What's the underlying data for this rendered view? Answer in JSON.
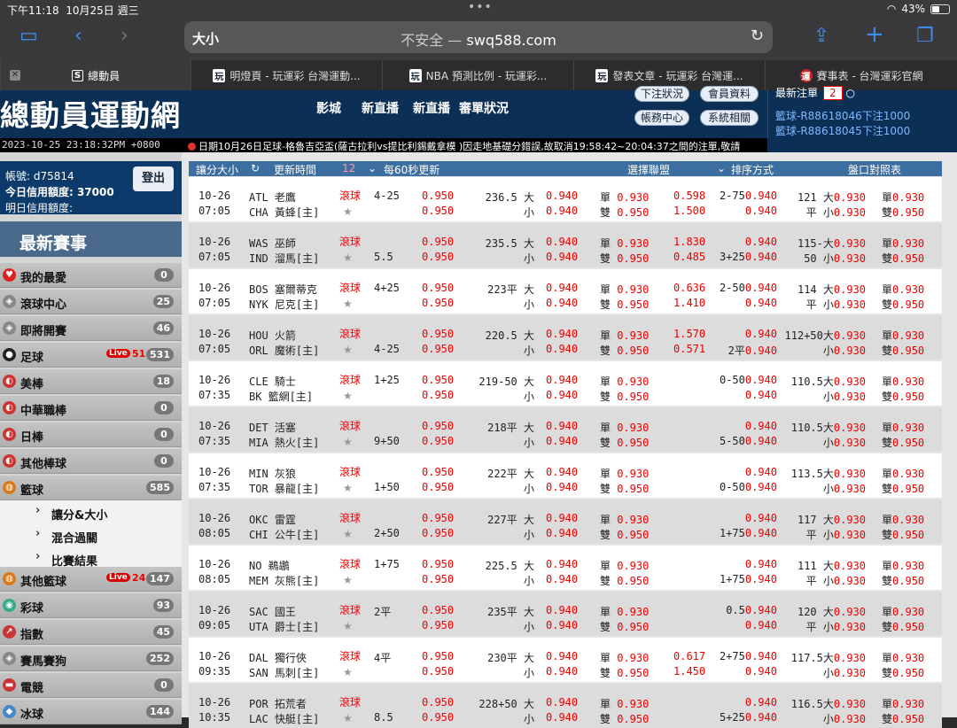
{
  "status": {
    "time": "下午11:18",
    "date": "10月25日 週三",
    "battery": "43%",
    "battery_level": 0.43,
    "dots": "•••"
  },
  "browser": {
    "aa": "大小",
    "insecure": "不安全 — ",
    "domain": "swq588.com",
    "tabs": [
      {
        "label": "總動員",
        "icon": "S"
      },
      {
        "label": "明燈頁 - 玩運彩 台灣運動...",
        "icon": "玩"
      },
      {
        "label": "NBA 預測比例 - 玩運彩...",
        "icon": "玩"
      },
      {
        "label": "發表文章 - 玩運彩 台灣運...",
        "icon": "玩"
      },
      {
        "label": "賽事表 - 台灣運彩官網",
        "icon": "運"
      }
    ]
  },
  "site": {
    "logo": "總動員運動網",
    "nav": [
      "影城",
      "新直播",
      "新直播",
      "審單狀況"
    ],
    "buttons": {
      "pending": "下注狀況",
      "member": "會員資料",
      "account": "帳務中心",
      "system": "系統相關"
    },
    "recent": {
      "label": "最新注單",
      "count": "2"
    },
    "recent_bets": [
      "籃球-R88618046下注1000",
      "籃球-R88618045下注1000"
    ],
    "ticker_time": "2023-10-25 23:18:32PM +0800",
    "ticker": "日期10月26日足球-格魯吉亞盃(薩古拉利vs提比利錫戴拿模 )因走地基礎分錯誤,故取消19:58:42~20:04:37之間的注單,敬請"
  },
  "account": {
    "id": "帳號: d75814",
    "credit": "今日信用額度: 37000",
    "tomorrow": "明日信用額度:",
    "logout": "登出"
  },
  "sidebar": {
    "title": "最新賽事",
    "items": [
      {
        "label": "我的最愛",
        "count": "0",
        "icon": "heart-icon",
        "color": "#e02020"
      },
      {
        "label": "滾球中心",
        "count": "25",
        "icon": "shield-icon",
        "color": "#888"
      },
      {
        "label": "即將開賽",
        "count": "46",
        "icon": "shield-icon",
        "color": "#888"
      },
      {
        "label": "足球",
        "count": "531",
        "icon": "soccer-icon",
        "color": "#222",
        "live": "Live",
        "live_count": "51"
      },
      {
        "label": "美棒",
        "count": "18",
        "icon": "baseball-icon",
        "color": "#c33"
      },
      {
        "label": "中華職棒",
        "count": "0",
        "icon": "baseball-icon",
        "color": "#c33"
      },
      {
        "label": "日棒",
        "count": "0",
        "icon": "baseball-icon",
        "color": "#c33"
      },
      {
        "label": "其他棒球",
        "count": "0",
        "icon": "baseball-icon",
        "color": "#c33"
      },
      {
        "label": "籃球",
        "count": "585",
        "icon": "basketball-icon",
        "color": "#d87a1a"
      }
    ],
    "subs": [
      "讓分&大小",
      "混合過關",
      "比賽結果"
    ],
    "items2": [
      {
        "label": "其他籃球",
        "count": "147",
        "icon": "basketball-icon",
        "color": "#d87a1a",
        "live": "Live",
        "live_count": "24"
      },
      {
        "label": "彩球",
        "count": "93",
        "icon": "lottery-icon",
        "color": "#3a8"
      },
      {
        "label": "指數",
        "count": "45",
        "icon": "chart-icon",
        "color": "#c33"
      },
      {
        "label": "賽馬賽狗",
        "count": "252",
        "icon": "shield-icon",
        "color": "#888"
      },
      {
        "label": "電競",
        "count": "0",
        "icon": "gamepad-icon",
        "color": "#c33"
      },
      {
        "label": "冰球",
        "count": "144",
        "icon": "hockey-icon",
        "color": "#48c"
      }
    ]
  },
  "table": {
    "headers": [
      "讓分大小",
      "更新時間",
      "每60秒更新",
      "選擇聯盟",
      "排序方式",
      "盤口對照表"
    ],
    "sel_mark": "12",
    "rows": [
      {
        "date": "10-26",
        "time": "07:05",
        "home": "ATL 老鷹",
        "away": "CHA 黃蜂[主]",
        "live": "滾球",
        "hc1": "4-25",
        "hc2": "",
        "o1": "0.950",
        "o2": "0.950",
        "tot": "236.5 大",
        "tu": "小",
        "t1": "0.940",
        "t2": "0.940",
        "oe1": "單 0.930",
        "oe2": "雙 0.950",
        "m1": "0.598",
        "m2": "1.500",
        "s1": "2-750.940",
        "s2": "0.940",
        "f1": "121 大0.930",
        "f2": "平 小0.930",
        "g1": "單0.930",
        "g2": "雙0.950"
      },
      {
        "date": "10-26",
        "time": "07:05",
        "home": "WAS 巫師",
        "away": "IND 溜馬[主]",
        "live": "滾球",
        "hc1": "",
        "hc2": "5.5",
        "o1": "0.950",
        "o2": "0.950",
        "tot": "235.5 大",
        "tu": "小",
        "t1": "0.940",
        "t2": "0.940",
        "oe1": "單 0.930",
        "oe2": "雙 0.950",
        "m1": "1.830",
        "m2": "0.485",
        "s1": "0.940",
        "s2": "3+250.940",
        "f1": "115-大0.930",
        "f2": "50 小0.930",
        "g1": "單0.930",
        "g2": "雙0.950"
      },
      {
        "date": "10-26",
        "time": "07:05",
        "home": "BOS 塞爾蒂克",
        "away": "NYK 尼克[主]",
        "live": "滾球",
        "hc1": "4+25",
        "hc2": "",
        "o1": "0.950",
        "o2": "0.950",
        "tot": "223平 大",
        "tu": "小",
        "t1": "0.940",
        "t2": "0.940",
        "oe1": "單 0.930",
        "oe2": "雙 0.950",
        "m1": "0.636",
        "m2": "1.410",
        "s1": "2-500.940",
        "s2": "0.940",
        "f1": "114 大0.930",
        "f2": "平 小0.930",
        "g1": "單0.930",
        "g2": "雙0.950"
      },
      {
        "date": "10-26",
        "time": "07:05",
        "home": "HOU 火箭",
        "away": "ORL 魔術[主]",
        "live": "滾球",
        "hc1": "",
        "hc2": "4-25",
        "o1": "0.950",
        "o2": "0.950",
        "tot": "220.5 大",
        "tu": "小",
        "t1": "0.940",
        "t2": "0.940",
        "oe1": "單 0.930",
        "oe2": "雙 0.950",
        "m1": "1.570",
        "m2": "0.571",
        "s1": "0.940",
        "s2": "2平0.940",
        "f1": "112+50大0.930",
        "f2": "小0.930",
        "g1": "單0.930",
        "g2": "雙0.950"
      },
      {
        "date": "10-26",
        "time": "07:35",
        "home": "CLE 騎士",
        "away": "BK 籃網[主]",
        "live": "滾球",
        "hc1": "1+25",
        "hc2": "",
        "o1": "0.950",
        "o2": "0.950",
        "tot": "219-50 大",
        "tu": "小",
        "t1": "0.940",
        "t2": "0.940",
        "oe1": "單 0.930",
        "oe2": "雙 0.950",
        "m1": "",
        "m2": "",
        "s1": "0-500.940",
        "s2": "0.940",
        "f1": "110.5大0.930",
        "f2": "小0.930",
        "g1": "單0.930",
        "g2": "雙0.950"
      },
      {
        "date": "10-26",
        "time": "07:35",
        "home": "DET 活塞",
        "away": "MIA 熱火[主]",
        "live": "滾球",
        "hc1": "",
        "hc2": "9+50",
        "o1": "0.950",
        "o2": "0.950",
        "tot": "218平 大",
        "tu": "小",
        "t1": "0.940",
        "t2": "0.940",
        "oe1": "單 0.930",
        "oe2": "雙 0.950",
        "m1": "",
        "m2": "",
        "s1": "0.940",
        "s2": "5-500.940",
        "f1": "110.5大0.930",
        "f2": "小0.930",
        "g1": "單0.930",
        "g2": "雙0.950"
      },
      {
        "date": "10-26",
        "time": "07:35",
        "home": "MIN 灰狼",
        "away": "TOR 暴龍[主]",
        "live": "滾球",
        "hc1": "",
        "hc2": "1+50",
        "o1": "0.950",
        "o2": "0.950",
        "tot": "222平 大",
        "tu": "小",
        "t1": "0.940",
        "t2": "0.940",
        "oe1": "單 0.930",
        "oe2": "雙 0.950",
        "m1": "",
        "m2": "",
        "s1": "0.940",
        "s2": "0-500.940",
        "f1": "113.5大0.930",
        "f2": "小0.930",
        "g1": "單0.930",
        "g2": "雙0.950"
      },
      {
        "date": "10-26",
        "time": "08:05",
        "home": "OKC 雷霆",
        "away": "CHI 公牛[主]",
        "live": "滾球",
        "hc1": "",
        "hc2": "2+50",
        "o1": "0.950",
        "o2": "0.950",
        "tot": "227平 大",
        "tu": "小",
        "t1": "0.940",
        "t2": "0.940",
        "oe1": "單 0.930",
        "oe2": "雙 0.950",
        "m1": "",
        "m2": "",
        "s1": "0.940",
        "s2": "1+750.940",
        "f1": "117 大0.930",
        "f2": "平 小0.930",
        "g1": "單0.930",
        "g2": "雙0.950"
      },
      {
        "date": "10-26",
        "time": "08:05",
        "home": "NO 鵜鶘",
        "away": "MEM 灰熊[主]",
        "live": "滾球",
        "hc1": "1+75",
        "hc2": "",
        "o1": "0.950",
        "o2": "0.950",
        "tot": "225.5 大",
        "tu": "小",
        "t1": "0.940",
        "t2": "0.940",
        "oe1": "單 0.930",
        "oe2": "雙 0.950",
        "m1": "",
        "m2": "",
        "s1": "0.940",
        "s2": "1+750.940",
        "f1": "111 大0.930",
        "f2": "平 小0.930",
        "g1": "單0.930",
        "g2": "雙0.950"
      },
      {
        "date": "10-26",
        "time": "09:05",
        "home": "SAC 國王",
        "away": "UTA 爵士[主]",
        "live": "滾球",
        "hc1": "2平",
        "hc2": "",
        "o1": "0.950",
        "o2": "0.950",
        "tot": "235平 大",
        "tu": "小",
        "t1": "0.940",
        "t2": "0.940",
        "oe1": "單 0.930",
        "oe2": "雙 0.950",
        "m1": "",
        "m2": "",
        "s1": "0.50.940",
        "s2": "0.940",
        "f1": "120 大0.930",
        "f2": "平 小0.930",
        "g1": "單0.930",
        "g2": "雙0.950"
      },
      {
        "date": "10-26",
        "time": "09:35",
        "home": "DAL 獨行俠",
        "away": "SAN 馬刺[主]",
        "live": "滾球",
        "hc1": "4平",
        "hc2": "",
        "o1": "0.950",
        "o2": "0.950",
        "tot": "230平 大",
        "tu": "小",
        "t1": "0.940",
        "t2": "0.940",
        "oe1": "單 0.930",
        "oe2": "雙 0.950",
        "m1": "0.617",
        "m2": "1.450",
        "s1": "2+750.940",
        "s2": "0.940",
        "f1": "117.5大0.930",
        "f2": "小0.930",
        "g1": "單0.930",
        "g2": "雙0.950"
      },
      {
        "date": "10-26",
        "time": "10:35",
        "home": "POR 拓荒者",
        "away": "LAC 快艇[主]",
        "live": "滾球",
        "hc1": "",
        "hc2": "8.5",
        "o1": "0.950",
        "o2": "0.950",
        "tot": "228+50 大",
        "tu": "小",
        "t1": "0.940",
        "t2": "0.940",
        "oe1": "單 0.930",
        "oe2": "雙 0.950",
        "m1": "",
        "m2": "",
        "s1": "0.940",
        "s2": "5+250.940",
        "f1": "116.5大0.930",
        "f2": "小0.930",
        "g1": "單0.930",
        "g2": "雙0.950"
      }
    ]
  }
}
